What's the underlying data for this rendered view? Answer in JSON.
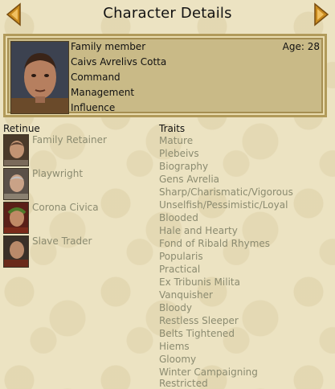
{
  "header": {
    "title": "Character Details"
  },
  "character": {
    "role": "Family member",
    "age": "Age: 28",
    "name": "Caivs Avrelivs Cotta",
    "attributes": [
      "Command",
      "Management",
      "Influence"
    ]
  },
  "retinue": {
    "heading": "Retinue",
    "items": [
      {
        "label": "Family Retainer",
        "icon": "portrait-retainer"
      },
      {
        "label": "Playwright",
        "icon": "portrait-playwright"
      },
      {
        "label": "Corona Civica",
        "icon": "portrait-corona"
      },
      {
        "label": "Slave Trader",
        "icon": "portrait-slave-trader"
      }
    ]
  },
  "traits": {
    "heading": "Traits",
    "items": [
      "Mature",
      "Plebeivs",
      "Biography",
      "Gens Avrelia",
      "Sharp/Charismatic/Vigorous",
      "Unselfish/Pessimistic/Loyal",
      "Blooded",
      "Hale and Hearty",
      "Fond of Ribald Rhymes",
      "Popularis",
      "Practical",
      "Ex Tribunis Milita",
      "Vanquisher",
      "Bloody",
      "Restless Sleeper",
      "Belts Tightened",
      "Hiems",
      "Gloomy",
      "Winter Campaigning",
      "Restricted"
    ]
  },
  "colors": {
    "accent": "#c88a1e",
    "panel": "#c9ba87",
    "muted_text": "#8b8b70"
  }
}
